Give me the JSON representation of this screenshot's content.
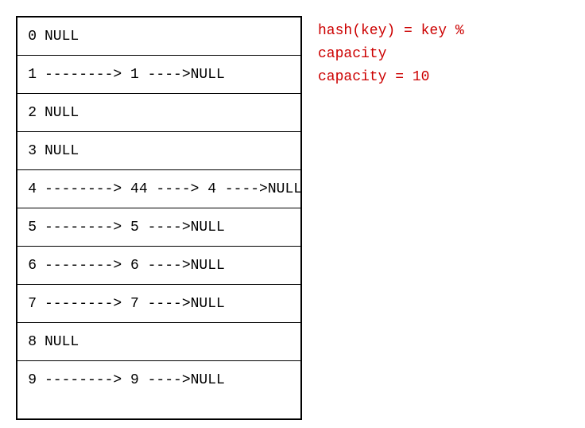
{
  "table": {
    "rows": [
      {
        "index": "0",
        "content": "NULL",
        "type": "null"
      },
      {
        "index": "1",
        "content": "--------> 1 ---->NULL",
        "type": "chain"
      },
      {
        "index": "2",
        "content": "NULL",
        "type": "null"
      },
      {
        "index": "3",
        "content": "NULL",
        "type": "null"
      },
      {
        "index": "4",
        "content": "--------> 44 ----> 4  ---->NULL",
        "type": "chain"
      },
      {
        "index": "5",
        "content": "--------> 5  ---->NULL",
        "type": "chain"
      },
      {
        "index": "6",
        "content": "--------> 6  ---->NULL",
        "type": "chain"
      },
      {
        "index": "7",
        "content": "--------> 7  ---->NULL",
        "type": "chain"
      },
      {
        "index": "8",
        "content": "NULL",
        "type": "null"
      },
      {
        "index": "9",
        "content": "--------> 9  ---->NULL",
        "type": "chain"
      }
    ]
  },
  "info": {
    "line1": "hash(key) = key %",
    "line2": "capacity",
    "line3": "capacity = 10"
  }
}
